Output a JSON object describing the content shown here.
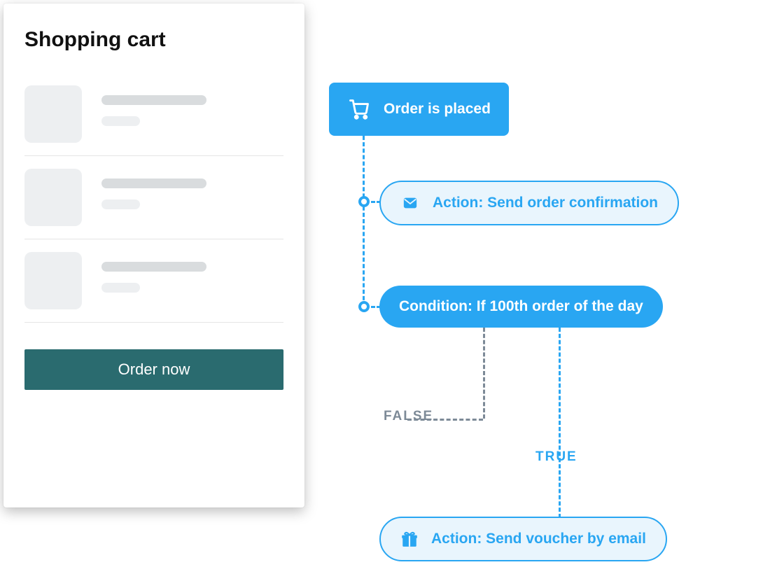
{
  "cart": {
    "title": "Shopping cart",
    "order_button": "Order now"
  },
  "flow": {
    "trigger": {
      "label": "Order is placed",
      "icon": "cart-icon"
    },
    "action1": {
      "label": "Action: Send order confirmation",
      "icon": "mail-icon"
    },
    "condition": {
      "label": "Condition: If 100th order of the day"
    },
    "branch_false": "FALSE",
    "branch_true": "TRUE",
    "action2": {
      "label": "Action: Send voucher by email",
      "icon": "gift-icon"
    }
  }
}
